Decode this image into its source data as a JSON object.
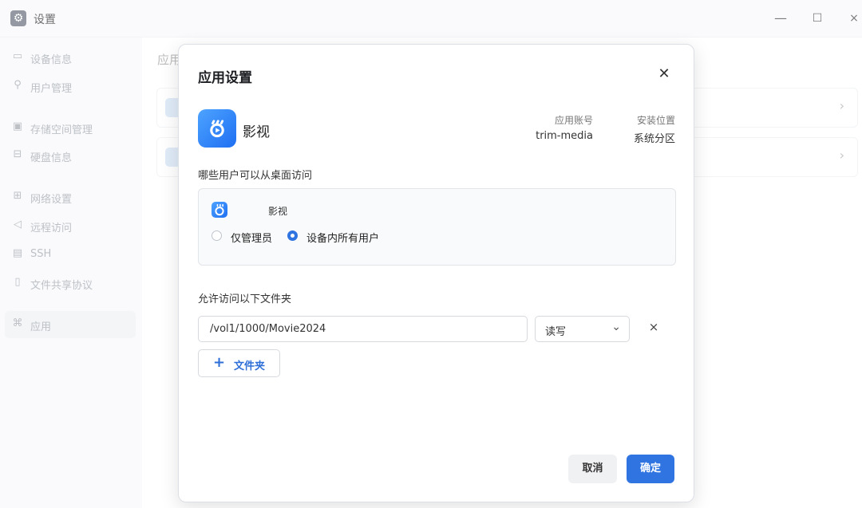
{
  "window": {
    "title": "设置",
    "icon": "gear-icon",
    "minimize": "—",
    "maximize": "☐",
    "close": "×"
  },
  "sidebar": {
    "items": [
      {
        "label": "设备信息",
        "icon": "monitor-icon",
        "glyph": "▭"
      },
      {
        "label": "用户管理",
        "icon": "user-icon",
        "glyph": "⚲"
      },
      {
        "label": "存储空间管理",
        "icon": "storage-icon",
        "glyph": "▣"
      },
      {
        "label": "硬盘信息",
        "icon": "disk-icon",
        "glyph": "⊟"
      },
      {
        "label": "网络设置",
        "icon": "network-icon",
        "glyph": "⊞"
      },
      {
        "label": "远程访问",
        "icon": "send-icon",
        "glyph": "◁"
      },
      {
        "label": "SSH",
        "icon": "terminal-icon",
        "glyph": "▤"
      },
      {
        "label": "文件共享协议",
        "icon": "document-icon",
        "glyph": "▯"
      },
      {
        "label": "应用",
        "icon": "apps-icon",
        "glyph": "⌘"
      }
    ]
  },
  "main": {
    "title_partial": "应用"
  },
  "dialog": {
    "title": "应用设置",
    "close": "✕",
    "app": {
      "name": "影视",
      "account_label": "应用账号",
      "account_value": "trim-media",
      "location_label": "安装位置",
      "location_value": "系统分区"
    },
    "users_section": {
      "label": "哪些用户可以从桌面访问",
      "app_name": "影视",
      "options": [
        {
          "label": "仅管理员",
          "selected": false
        },
        {
          "label": "设备内所有用户",
          "selected": true
        }
      ]
    },
    "folders_section": {
      "label": "允许访问以下文件夹",
      "rows": [
        {
          "path": "/vol1/1000/Movie2024",
          "permission": "读写"
        }
      ],
      "remove": "×",
      "add_label": "文件夹",
      "add_plus": "+"
    },
    "buttons": {
      "cancel": "取消",
      "ok": "确定"
    }
  },
  "colors": {
    "accent": "#2f74e0",
    "app_icon_start": "#4da3ff",
    "app_icon_end": "#1f6ff2"
  }
}
